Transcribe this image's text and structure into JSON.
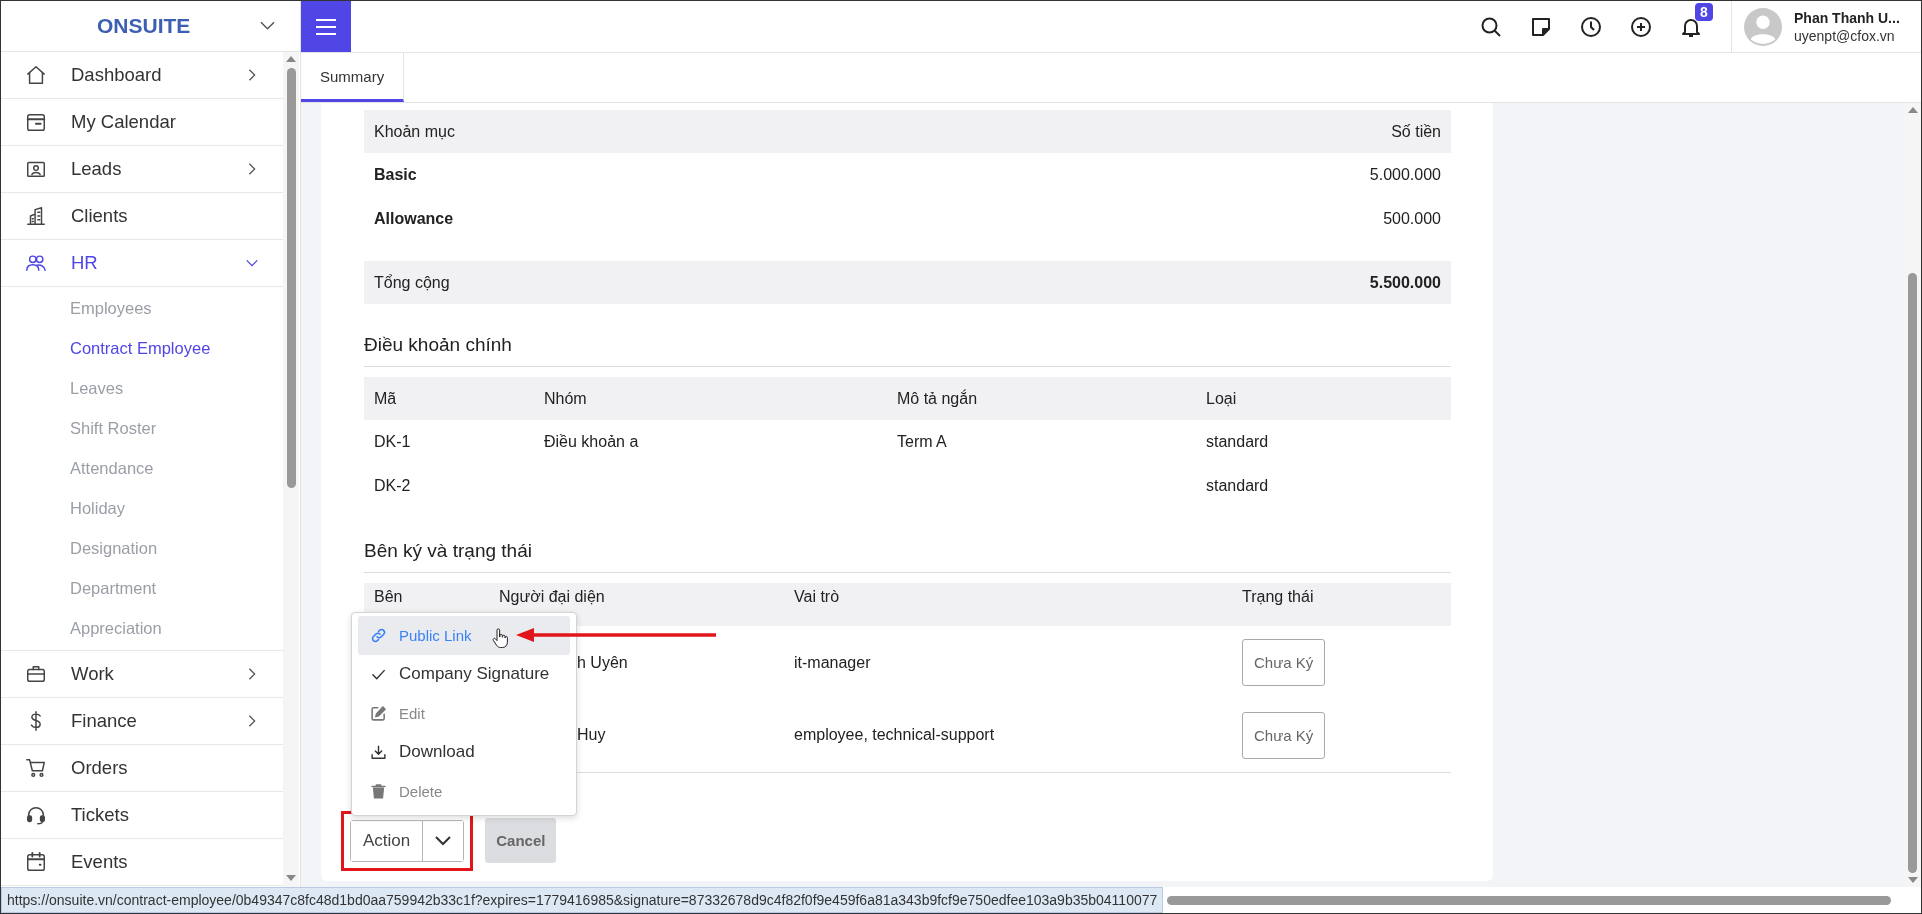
{
  "app": {
    "logo": "ONSUITE"
  },
  "sidebar": {
    "items": [
      {
        "label": "Dashboard",
        "expanded": false,
        "selected": false
      },
      {
        "label": "My Calendar",
        "selected": false
      },
      {
        "label": "Leads",
        "expanded": false,
        "selected": false
      },
      {
        "label": "Clients",
        "selected": false
      },
      {
        "label": "HR",
        "expanded": true,
        "selected": true,
        "children": [
          {
            "label": "Employees",
            "selected": false
          },
          {
            "label": "Contract Employee",
            "selected": true
          },
          {
            "label": "Leaves",
            "selected": false
          },
          {
            "label": "Shift Roster",
            "selected": false
          },
          {
            "label": "Attendance",
            "selected": false
          },
          {
            "label": "Holiday",
            "selected": false
          },
          {
            "label": "Designation",
            "selected": false
          },
          {
            "label": "Department",
            "selected": false
          },
          {
            "label": "Appreciation",
            "selected": false
          }
        ]
      },
      {
        "label": "Work",
        "expanded": false,
        "selected": false
      },
      {
        "label": "Finance",
        "expanded": false,
        "selected": false
      },
      {
        "label": "Orders",
        "selected": false
      },
      {
        "label": "Tickets",
        "selected": false
      },
      {
        "label": "Events",
        "selected": false
      }
    ]
  },
  "header": {
    "notification_count": "8",
    "user": {
      "name": "Phan Thanh U...",
      "email": "uyenpt@cfox.vn"
    }
  },
  "tabs": [
    {
      "label": "Summary",
      "selected": true
    }
  ],
  "salary_table": {
    "columns": [
      "Khoản mục",
      "Số tiền"
    ],
    "rows": [
      {
        "item": "Basic",
        "amount": "5.000.000"
      },
      {
        "item": "Allowance",
        "amount": "500.000"
      }
    ],
    "total": {
      "label": "Tổng cộng",
      "amount": "5.500.000"
    }
  },
  "terms": {
    "title": "Điều khoản chính",
    "columns": [
      "Mã",
      "Nhóm",
      "Mô tả ngắn",
      "Loại"
    ],
    "rows": [
      [
        "DK-1",
        "Điều khoản a",
        "Term A",
        "standard"
      ],
      [
        "DK-2",
        "",
        "",
        "standard"
      ]
    ]
  },
  "signers": {
    "title": "Bên ký và trạng thái",
    "columns": [
      "Bên",
      "Người đại diện",
      "Vai trò",
      "Trạng thái"
    ],
    "rows": [
      {
        "representative": "h Uyên",
        "role": "it-manager",
        "status": "Chưa Ký"
      },
      {
        "representative": "Huy",
        "role": "employee, technical-support",
        "status": "Chưa Ký"
      }
    ]
  },
  "action_menu": {
    "items": [
      {
        "label": "Public Link",
        "selected": true,
        "disabled": false
      },
      {
        "label": "Company Signature",
        "selected": false,
        "disabled": false
      },
      {
        "label": "Edit",
        "selected": false,
        "disabled": true
      },
      {
        "label": "Download",
        "selected": false,
        "disabled": false
      },
      {
        "label": "Delete",
        "selected": false,
        "disabled": true
      }
    ]
  },
  "buttons": {
    "action": "Action",
    "cancel": "Cancel"
  },
  "status_url": "https://onsuite.vn/contract-employee/0b49347c8fc48d1bd0aa759942b33c1f?expires=1779416985&signature=87332678d9c4f82f0f9e459f6a81a343b9fcf9e750edfee103a9b35b04110077"
}
